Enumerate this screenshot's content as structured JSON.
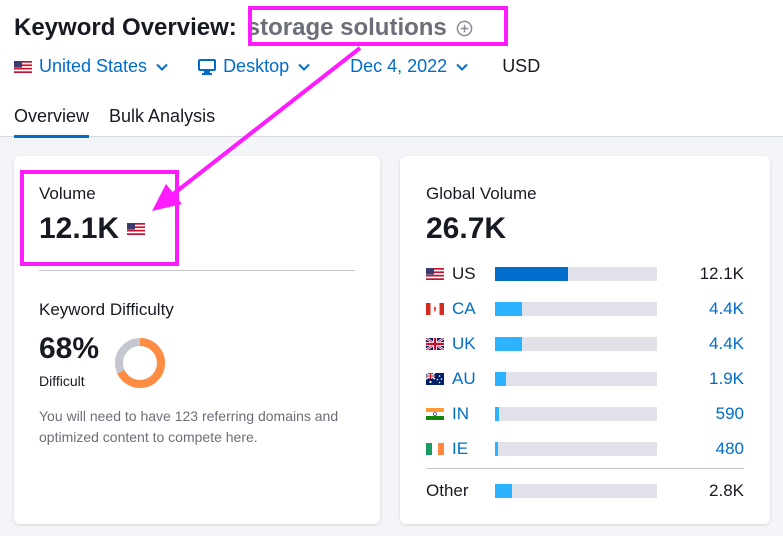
{
  "header": {
    "title_prefix": "Keyword Overview:",
    "keyword": "storage solutions",
    "filters": {
      "country": "United States",
      "device": "Desktop",
      "date": "Dec 4, 2022",
      "currency": "USD"
    },
    "tabs": [
      "Overview",
      "Bulk Analysis"
    ]
  },
  "volume": {
    "label": "Volume",
    "value": "12.1K"
  },
  "keyword_difficulty": {
    "label": "Keyword Difficulty",
    "value": "68%",
    "level": "Difficult",
    "percent": 68,
    "description": "You will need to have 123 referring domains and optimized content to compete here."
  },
  "global_volume": {
    "label": "Global Volume",
    "value": "26.7K",
    "countries": [
      {
        "code": "US",
        "value": "12.1K",
        "share": 0.45,
        "flag": "us-flag-icon"
      },
      {
        "code": "CA",
        "value": "4.4K",
        "share": 0.165,
        "flag": "ca-flag-icon"
      },
      {
        "code": "UK",
        "value": "4.4K",
        "share": 0.165,
        "flag": "uk-flag-icon"
      },
      {
        "code": "AU",
        "value": "1.9K",
        "share": 0.07,
        "flag": "au-flag-icon"
      },
      {
        "code": "IN",
        "value": "590",
        "share": 0.025,
        "flag": "in-flag-icon"
      },
      {
        "code": "IE",
        "value": "480",
        "share": 0.02,
        "flag": "ie-flag-icon"
      }
    ],
    "other": {
      "label": "Other",
      "value": "2.8K",
      "share": 0.105
    }
  },
  "colors": {
    "accent_blue": "#006dca",
    "light_blue": "#2bb3ff",
    "highlight_magenta": "#ff1aff",
    "difficulty_orange": "#ff8c43"
  }
}
